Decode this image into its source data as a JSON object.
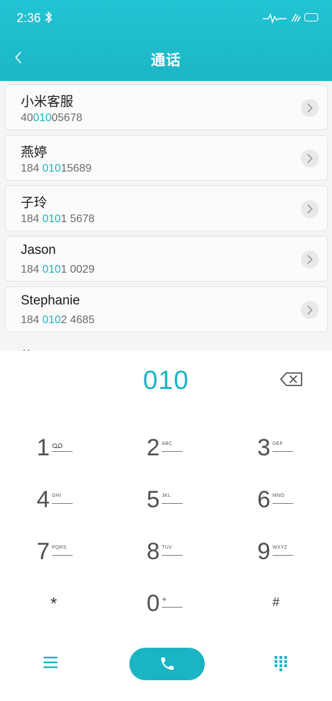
{
  "status_bar": {
    "time": "2:36"
  },
  "header": {
    "title": "通话"
  },
  "contacts": [
    {
      "name": "小米客服",
      "number_pre": "40",
      "number_match": "010",
      "number_post": "05678"
    },
    {
      "name": "燕婷",
      "number_pre": "184 ",
      "number_match": "010",
      "number_post": "15689"
    },
    {
      "name": "子玲",
      "number_pre": "184 ",
      "number_match": "010",
      "number_post": "1 5678"
    },
    {
      "name": "Jason",
      "number_pre": "184 ",
      "number_match": "010",
      "number_post": "1 0029"
    },
    {
      "name": "Stephanie",
      "number_pre": "184 ",
      "number_match": "010",
      "number_post": "2 4685"
    }
  ],
  "partial_contact": "苏三",
  "dialer": {
    "input": "010",
    "keys": [
      {
        "digit": "1",
        "letters": ""
      },
      {
        "digit": "2",
        "letters": "ABC"
      },
      {
        "digit": "3",
        "letters": "DEF"
      },
      {
        "digit": "4",
        "letters": "GHI"
      },
      {
        "digit": "5",
        "letters": "JKL"
      },
      {
        "digit": "6",
        "letters": "MNO"
      },
      {
        "digit": "7",
        "letters": "PQRS"
      },
      {
        "digit": "8",
        "letters": "TUV"
      },
      {
        "digit": "9",
        "letters": "WXYZ"
      },
      {
        "digit": "*",
        "letters": ""
      },
      {
        "digit": "0",
        "letters": "+"
      },
      {
        "digit": "#",
        "letters": ""
      }
    ]
  },
  "colors": {
    "accent": "#1ab4c5",
    "header": "#1cb6c6"
  },
  "icons": {
    "bluetooth": "bluetooth-icon",
    "signal": "signal-icon",
    "wifi": "wifi-icon",
    "battery": "battery-icon",
    "back": "back-icon",
    "chevron": "chevron-right-icon",
    "voicemail": "voicemail-icon",
    "backspace": "backspace-icon",
    "menu": "menu-icon",
    "phone": "phone-icon",
    "keypad": "keypad-icon"
  }
}
